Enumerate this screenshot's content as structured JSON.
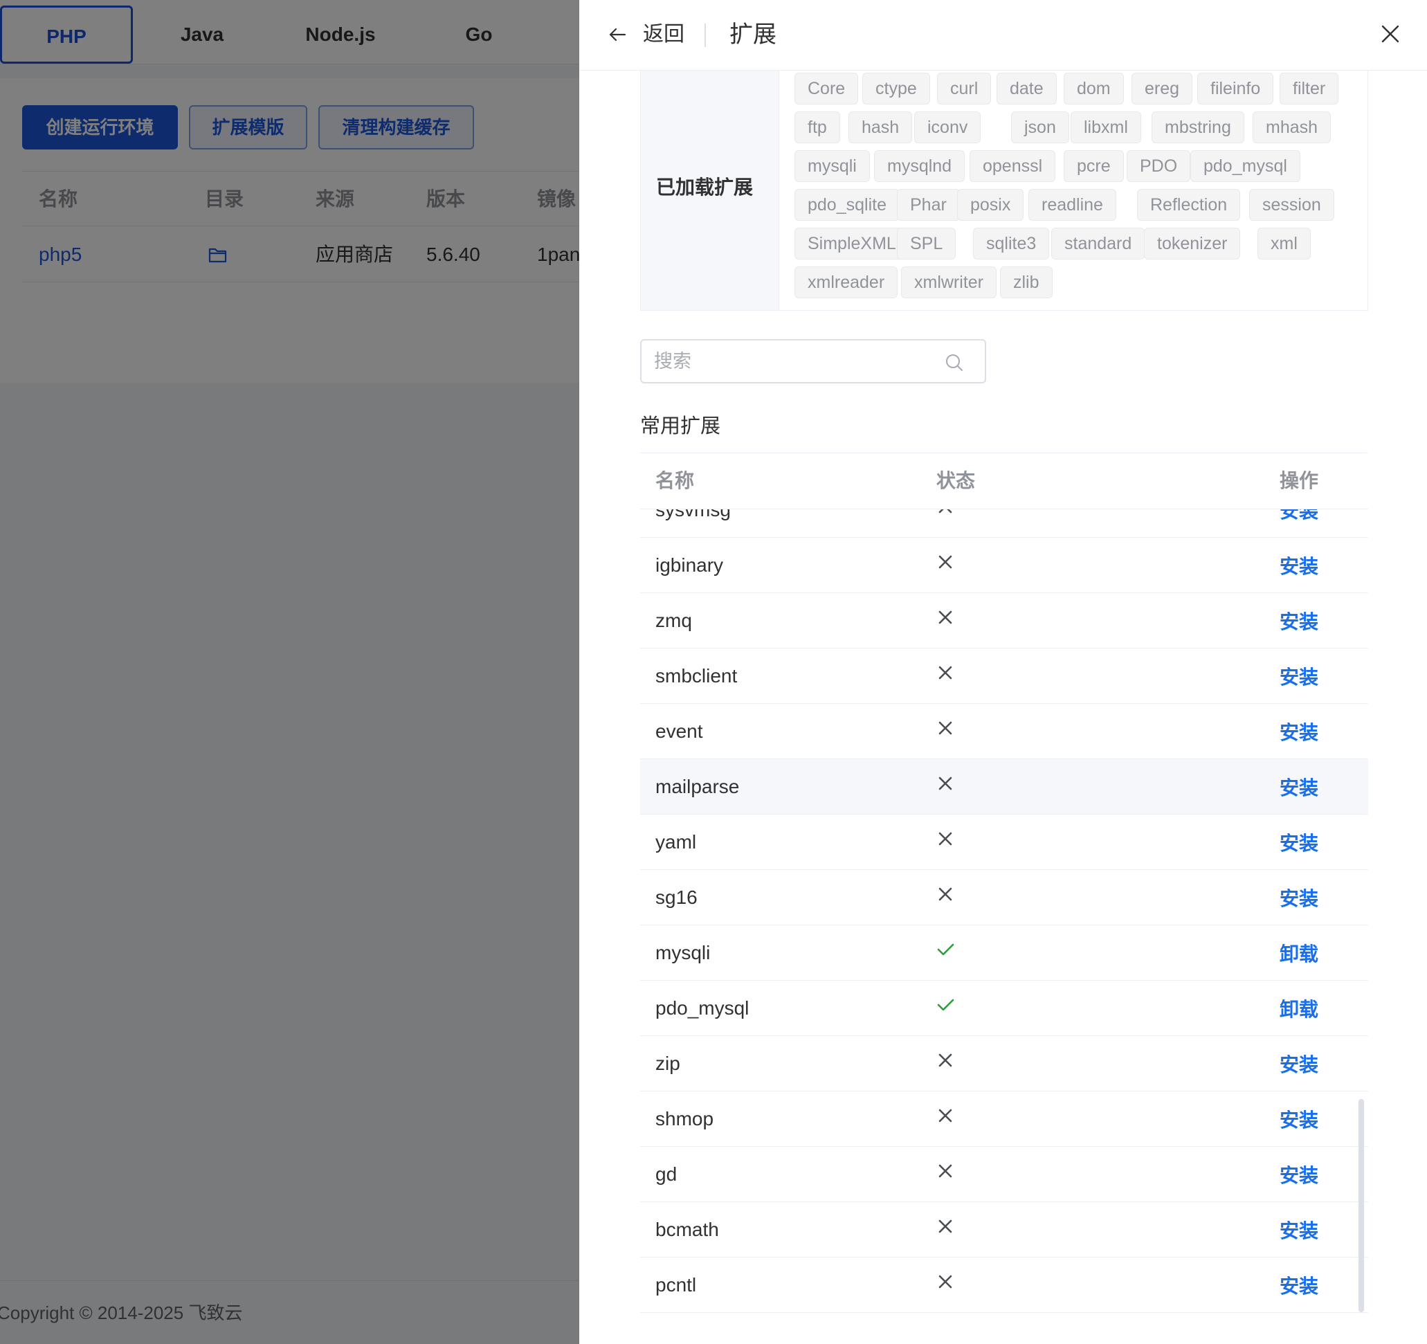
{
  "background": {
    "lang_tabs": [
      "PHP",
      "Java",
      "Node.js",
      "Go"
    ],
    "toolbar": {
      "create_label": "创建运行环境",
      "template_label": "扩展模版",
      "clear_cache_label": "清理构建缓存"
    },
    "table": {
      "headers": [
        "名称",
        "目录",
        "来源",
        "版本",
        "镜像"
      ],
      "row": {
        "name": "php5",
        "source": "应用商店",
        "version": "5.6.40",
        "image": "1pan"
      }
    },
    "footer": "Copyright © 2014-2025 飞致云"
  },
  "drawer": {
    "back_label": "返回",
    "title": "扩展",
    "loaded_label": "已加载扩展",
    "loaded_extensions": [
      "Core",
      "ctype",
      "curl",
      "date",
      "dom",
      "ereg",
      "fileinfo",
      "filter",
      "ftp",
      "hash",
      "iconv",
      "json",
      "libxml",
      "mbstring",
      "mhash",
      "mysqli",
      "mysqlnd",
      "openssl",
      "pcre",
      "PDO",
      "pdo_mysql",
      "pdo_sqlite",
      "Phar",
      "posix",
      "readline",
      "Reflection",
      "session",
      "SimpleXML",
      "SPL",
      "sqlite3",
      "standard",
      "tokenizer",
      "xml",
      "xmlreader",
      "xmlwriter",
      "zlib"
    ],
    "search_placeholder": "搜索",
    "section_title": "常用扩展",
    "columns": {
      "name": "名称",
      "status": "状态",
      "action": "操作"
    },
    "extensions": [
      {
        "name": "sysvmsg",
        "installed": false,
        "action": "安装"
      },
      {
        "name": "igbinary",
        "installed": false,
        "action": "安装"
      },
      {
        "name": "zmq",
        "installed": false,
        "action": "安装"
      },
      {
        "name": "smbclient",
        "installed": false,
        "action": "安装"
      },
      {
        "name": "event",
        "installed": false,
        "action": "安装"
      },
      {
        "name": "mailparse",
        "installed": false,
        "action": "安装"
      },
      {
        "name": "yaml",
        "installed": false,
        "action": "安装"
      },
      {
        "name": "sg16",
        "installed": false,
        "action": "安装"
      },
      {
        "name": "mysqli",
        "installed": true,
        "action": "卸载"
      },
      {
        "name": "pdo_mysql",
        "installed": true,
        "action": "卸载"
      },
      {
        "name": "zip",
        "installed": false,
        "action": "安装"
      },
      {
        "name": "shmop",
        "installed": false,
        "action": "安装"
      },
      {
        "name": "gd",
        "installed": false,
        "action": "安装"
      },
      {
        "name": "bcmath",
        "installed": false,
        "action": "安装"
      },
      {
        "name": "pcntl",
        "installed": false,
        "action": "安装"
      }
    ],
    "hovered_row": "mailparse"
  },
  "colors": {
    "accent": "#1a56db",
    "link": "#1a6fe8",
    "success": "#2e9d3a",
    "muted": "#606266"
  },
  "icons": {
    "back": "arrow-left-icon",
    "close": "close-icon",
    "search": "search-icon",
    "folder": "folder-icon",
    "not_installed": "cross-icon",
    "installed": "check-icon"
  }
}
